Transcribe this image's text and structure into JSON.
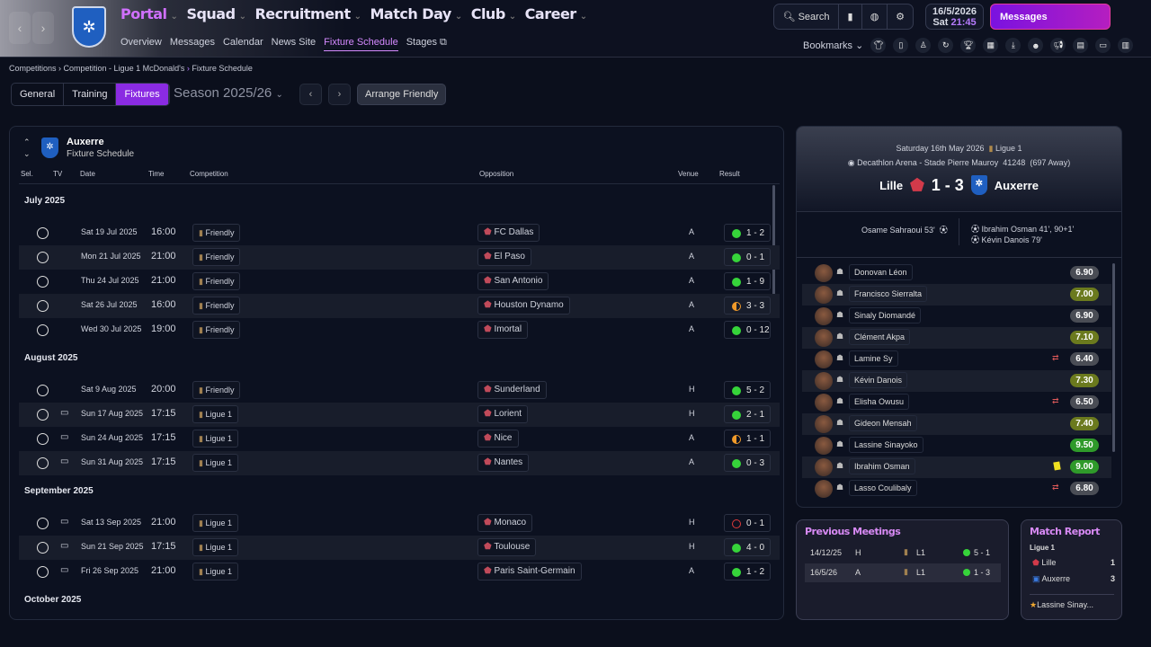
{
  "nav": {
    "back": "‹",
    "forward": "›",
    "menu": [
      "Portal",
      "Squad",
      "Recruitment",
      "Match Day",
      "Club",
      "Career"
    ],
    "submenu": [
      "Overview",
      "Messages",
      "Calendar",
      "News Site",
      "Fixture Schedule",
      "Stages"
    ],
    "search": "Search",
    "date": "16/5/2026",
    "day": "Sat",
    "time": "21:45",
    "messages": "Messages",
    "bookmarks": "Bookmarks",
    "accent": "#8a2be2"
  },
  "breadcrumb": [
    "Competitions",
    "Competition - Ligue 1 McDonald's",
    "Fixture Schedule"
  ],
  "tabs": [
    "General",
    "Training",
    "Fixtures"
  ],
  "season": "Season 2025/26",
  "arrange": "Arrange Friendly",
  "schedule": {
    "team": "Auxerre",
    "subtitle": "Fixture Schedule",
    "columns": [
      "Sel.",
      "TV",
      "Date",
      "Time",
      "Competition",
      "Opposition",
      "Venue",
      "Result"
    ],
    "groups": [
      {
        "month": "July 2025",
        "rows": [
          {
            "tv": false,
            "date": "Sat 19 Jul 2025",
            "time": "16:00",
            "comp": "Friendly",
            "opp": "FC Dallas",
            "venue": "A",
            "result": "1 - 2",
            "outcome": "win"
          },
          {
            "tv": false,
            "date": "Mon 21 Jul 2025",
            "time": "21:00",
            "comp": "Friendly",
            "opp": "El Paso",
            "venue": "A",
            "result": "0 - 1",
            "outcome": "win"
          },
          {
            "tv": false,
            "date": "Thu 24 Jul 2025",
            "time": "21:00",
            "comp": "Friendly",
            "opp": "San Antonio",
            "venue": "A",
            "result": "1 - 9",
            "outcome": "win"
          },
          {
            "tv": false,
            "date": "Sat 26 Jul 2025",
            "time": "16:00",
            "comp": "Friendly",
            "opp": "Houston Dynamo",
            "venue": "A",
            "result": "3 - 3",
            "outcome": "draw"
          },
          {
            "tv": false,
            "date": "Wed 30 Jul 2025",
            "time": "19:00",
            "comp": "Friendly",
            "opp": "Imortal",
            "venue": "A",
            "result": "0 - 12",
            "outcome": "win"
          }
        ]
      },
      {
        "month": "August 2025",
        "rows": [
          {
            "tv": false,
            "date": "Sat 9 Aug 2025",
            "time": "20:00",
            "comp": "Friendly",
            "opp": "Sunderland",
            "venue": "H",
            "result": "5 - 2",
            "outcome": "win"
          },
          {
            "tv": true,
            "date": "Sun 17 Aug 2025",
            "time": "17:15",
            "comp": "Ligue 1",
            "opp": "Lorient",
            "venue": "H",
            "result": "2 - 1",
            "outcome": "win"
          },
          {
            "tv": true,
            "date": "Sun 24 Aug 2025",
            "time": "17:15",
            "comp": "Ligue 1",
            "opp": "Nice",
            "venue": "A",
            "result": "1 - 1",
            "outcome": "draw"
          },
          {
            "tv": true,
            "date": "Sun 31 Aug 2025",
            "time": "17:15",
            "comp": "Ligue 1",
            "opp": "Nantes",
            "venue": "A",
            "result": "0 - 3",
            "outcome": "win"
          }
        ]
      },
      {
        "month": "September 2025",
        "rows": [
          {
            "tv": true,
            "date": "Sat 13 Sep 2025",
            "time": "21:00",
            "comp": "Ligue 1",
            "opp": "Monaco",
            "venue": "H",
            "result": "0 - 1",
            "outcome": "loss"
          },
          {
            "tv": true,
            "date": "Sun 21 Sep 2025",
            "time": "17:15",
            "comp": "Ligue 1",
            "opp": "Toulouse",
            "venue": "H",
            "result": "4 - 0",
            "outcome": "win"
          },
          {
            "tv": true,
            "date": "Fri 26 Sep 2025",
            "time": "21:00",
            "comp": "Ligue 1",
            "opp": "Paris Saint-Germain",
            "venue": "A",
            "result": "1 - 2",
            "outcome": "win"
          }
        ]
      },
      {
        "month": "October 2025",
        "rows": []
      }
    ]
  },
  "match": {
    "date": "Saturday 16th May 2026",
    "competition": "Ligue 1",
    "stadium": "Decathlon Arena - Stade Pierre Mauroy",
    "attendance": "41248",
    "away": "(697 Away)",
    "home_team": "Lille",
    "away_team": "Auxerre",
    "score": "1 - 3",
    "home_scorers": [
      "Osame Sahraoui 53'"
    ],
    "away_scorers": [
      "Ibrahim Osman 41', 90+1'",
      "Kévin Danois 79'"
    ],
    "players": [
      {
        "name": "Donovan Léon",
        "rating": "6.90",
        "event": ""
      },
      {
        "name": "Francisco Sierralta",
        "rating": "7.00",
        "event": ""
      },
      {
        "name": "Sinaly Diomandé",
        "rating": "6.90",
        "event": ""
      },
      {
        "name": "Clément Akpa",
        "rating": "7.10",
        "event": ""
      },
      {
        "name": "Lamine Sy",
        "rating": "6.40",
        "event": "sub"
      },
      {
        "name": "Kévin Danois",
        "rating": "7.30",
        "event": ""
      },
      {
        "name": "Elisha Owusu",
        "rating": "6.50",
        "event": "sub"
      },
      {
        "name": "Gideon Mensah",
        "rating": "7.40",
        "event": ""
      },
      {
        "name": "Lassine Sinayoko",
        "rating": "9.50",
        "event": ""
      },
      {
        "name": "Ibrahim Osman",
        "rating": "9.00",
        "event": "yellow"
      },
      {
        "name": "Lasso Coulibaly",
        "rating": "6.80",
        "event": "sub"
      }
    ]
  },
  "previous": {
    "title": "Previous Meetings",
    "rows": [
      {
        "date": "14/12/25",
        "venue": "H",
        "comp": "L1",
        "score": "5 - 1"
      },
      {
        "date": "16/5/26",
        "venue": "A",
        "comp": "L1",
        "score": "1 - 3"
      }
    ]
  },
  "report": {
    "title": "Match Report",
    "competition": "Ligue 1",
    "teams": [
      {
        "name": "Lille",
        "goals": "1"
      },
      {
        "name": "Auxerre",
        "goals": "3"
      }
    ],
    "motm": "Lassine Sinay..."
  }
}
